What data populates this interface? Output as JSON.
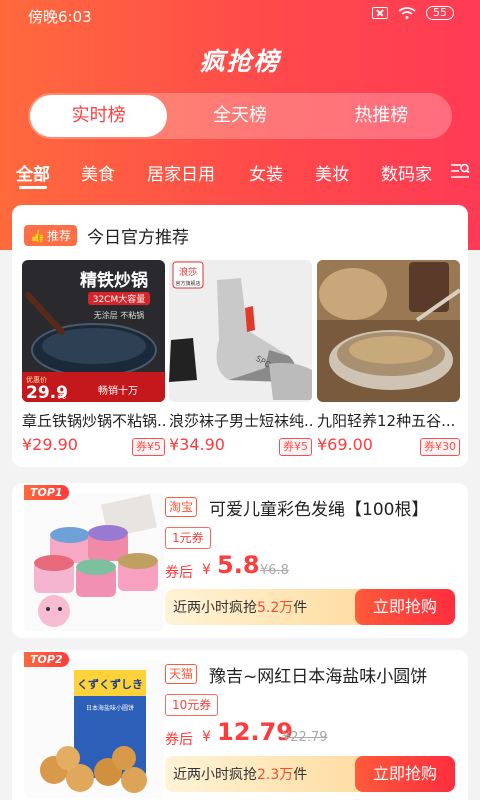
{
  "status": {
    "time": "傍晚6:03",
    "battery": "55"
  },
  "app": {
    "title": "疯抢榜"
  },
  "segments": [
    "实时榜",
    "全天榜",
    "热推榜"
  ],
  "categories": [
    "全部",
    "美食",
    "居家日用",
    "女装",
    "美妆",
    "数码家"
  ],
  "recommend": {
    "badge": "推荐",
    "title": "今日官方推荐",
    "items": [
      {
        "name": "章丘铁锅炒锅不粘锅...",
        "price": "¥29.90",
        "coupon": "券¥5",
        "img_text": "精铁炒锅",
        "img_sub": "32CM大容量",
        "img_sub2": "无涂层  不粘锅",
        "img_price": "29.9",
        "img_price_label": "优惠价",
        "img_price_unit": "元",
        "img_tag": "畅销十万"
      },
      {
        "name": "浪莎袜子男士短袜纯...",
        "price": "¥34.90",
        "coupon": "券¥5",
        "img_text": "浪莎",
        "img_sub": "官方旗舰店",
        "img_side": "SPORT"
      },
      {
        "name": "九阳轻养12种五谷...",
        "price": "¥69.00",
        "coupon": "券¥30"
      }
    ]
  },
  "products": [
    {
      "rank": "TOP1",
      "shop": "淘宝",
      "title": "可爱儿童彩色发绳【100根】",
      "coupon": "1元券",
      "after_label": "券后",
      "yen": "¥",
      "price": "5.8",
      "orig": "¥6.8",
      "sold_prefix": "近两小时疯抢",
      "sold_num": "5.2万",
      "sold_suffix": "件",
      "buy": "立即抢购"
    },
    {
      "rank": "TOP2",
      "shop": "天猫",
      "title": "豫吉~网红日本海盐味小圆饼",
      "coupon": "10元券",
      "after_label": "券后",
      "yen": "¥",
      "price": "12.79",
      "orig": "¥22.79",
      "sold_prefix": "近两小时疯抢",
      "sold_num": "2.3万",
      "sold_suffix": "件",
      "buy": "立即抢购",
      "img_text": "くずくずしき",
      "img_sub": "日本海盐味小圆饼"
    }
  ],
  "colors": {
    "accent": "#ff3f3f",
    "header_start": "#ff6a3d",
    "header_end": "#ff3a55"
  }
}
